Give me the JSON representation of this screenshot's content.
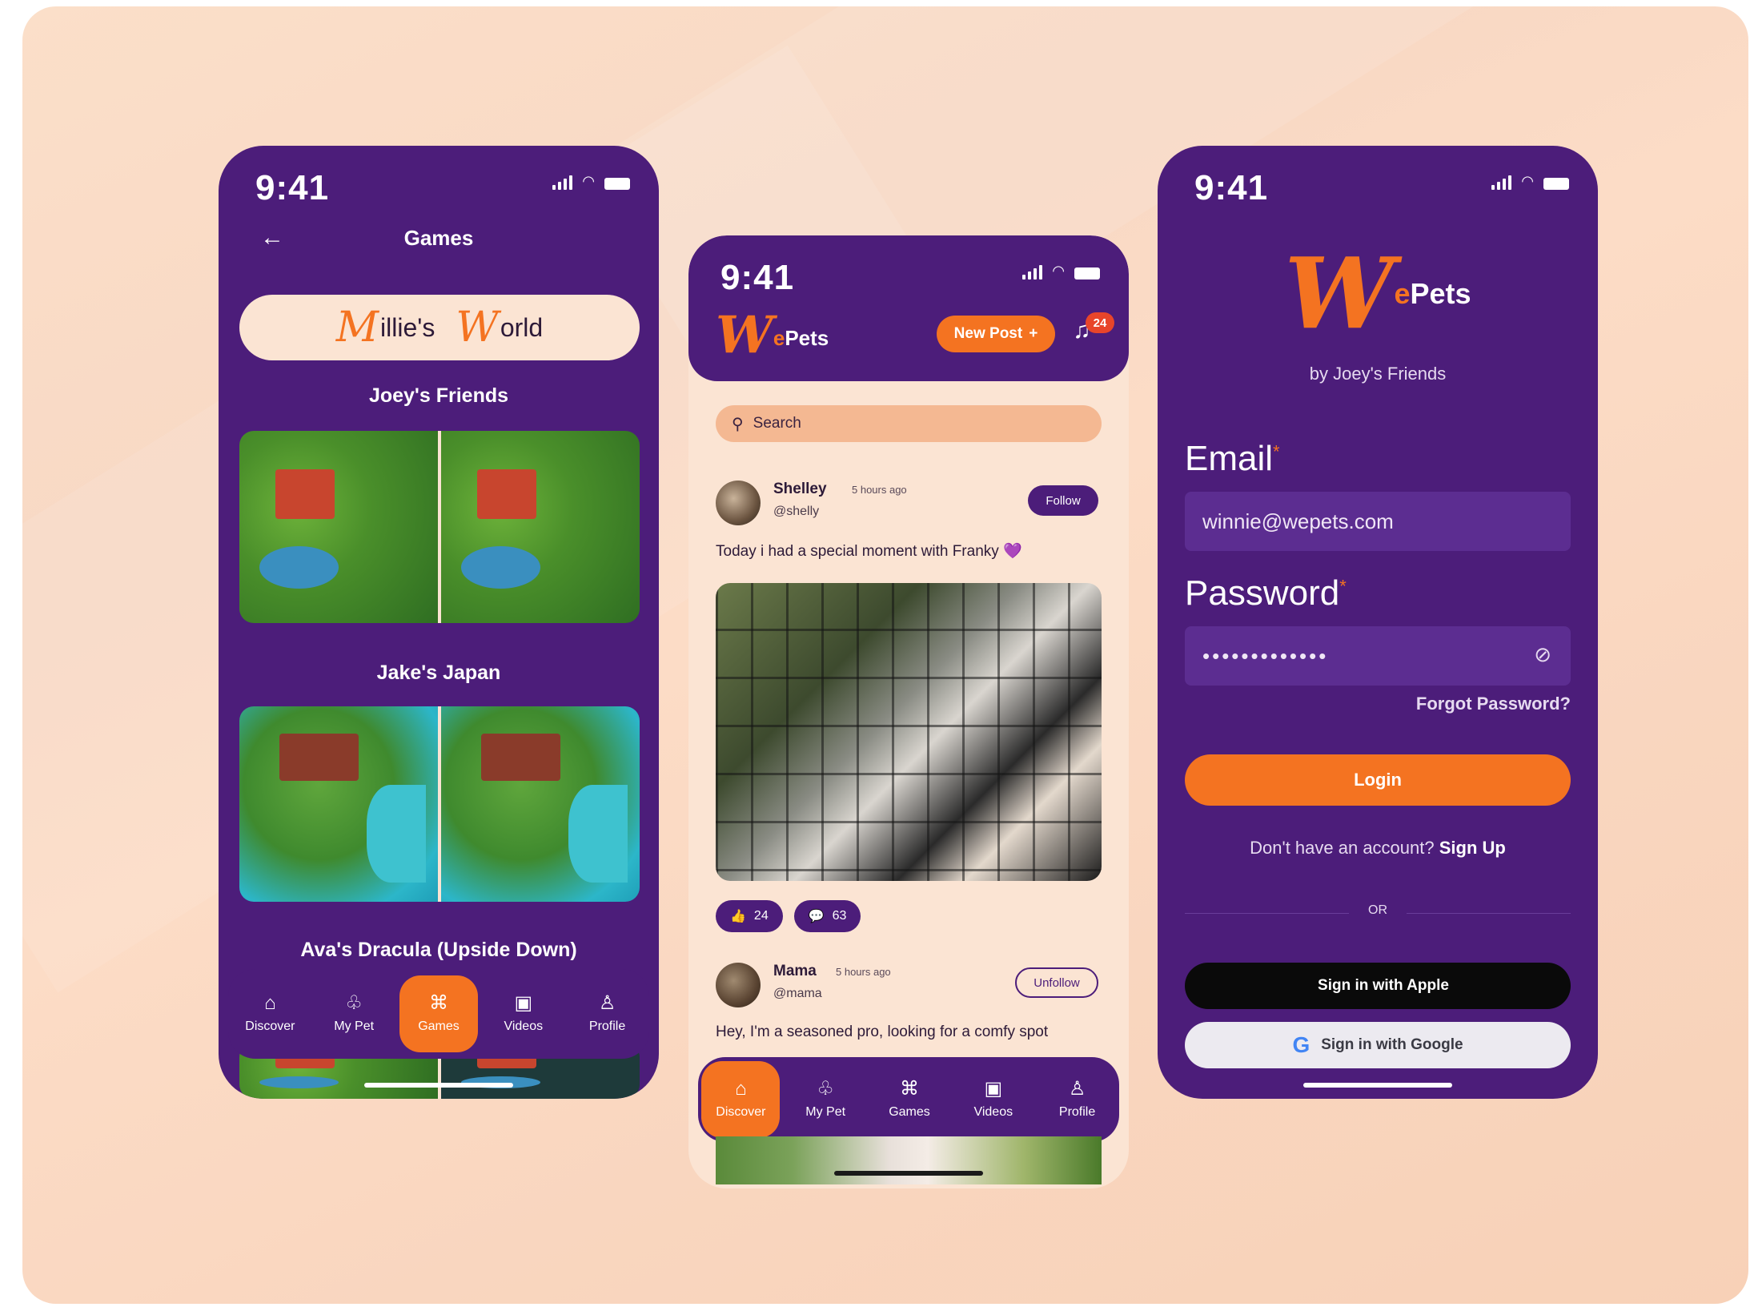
{
  "status": {
    "time": "9:41"
  },
  "games_screen": {
    "title": "Games",
    "banner": {
      "cap1": "M",
      "word1": "illie's",
      "cap2": "W",
      "word2": "orld"
    },
    "sections": [
      "Joey's Friends",
      "Jake's Japan",
      "Ava's Dracula (Upside Down)"
    ],
    "nav": [
      {
        "label": "Discover",
        "icon": "⌂"
      },
      {
        "label": "My Pet",
        "icon": "♧"
      },
      {
        "label": "Games",
        "icon": "⌘"
      },
      {
        "label": "Videos",
        "icon": "▣"
      },
      {
        "label": "Profile",
        "icon": "♙"
      }
    ],
    "active_tab": "Games"
  },
  "feed_screen": {
    "logo": {
      "w": "W",
      "e": "e",
      "pets": "Pets"
    },
    "new_post": "New Post",
    "new_post_icon": "+",
    "notification_count": "24",
    "search_placeholder": "Search",
    "posts": [
      {
        "name": "Shelley",
        "time": "5 hours ago",
        "handle": "@shelly",
        "action": "Follow",
        "text": "Today i had a special moment with Franky 💜",
        "likes": "24",
        "comments": "63"
      },
      {
        "name": "Mama",
        "time": "5 hours ago",
        "handle": "@mama",
        "action": "Unfollow",
        "text": "Hey, I'm a seasoned pro, looking for a comfy spot"
      }
    ],
    "nav": [
      {
        "label": "Discover",
        "icon": "⌂"
      },
      {
        "label": "My Pet",
        "icon": "♧"
      },
      {
        "label": "Games",
        "icon": "⌘"
      },
      {
        "label": "Videos",
        "icon": "▣"
      },
      {
        "label": "Profile",
        "icon": "♙"
      }
    ],
    "active_tab": "Discover"
  },
  "login_screen": {
    "logo": {
      "w": "W",
      "e": "e",
      "pets": "Pets"
    },
    "byline": "by Joey's Friends",
    "email_label": "Email",
    "email_value": "winnie@wepets.com",
    "password_label": "Password",
    "password_value": "•••••••••••••",
    "required_mark": "*",
    "forgot": "Forgot Password?",
    "login": "Login",
    "no_account": "Don't have an account?",
    "sign_up": "Sign Up",
    "or": "OR",
    "apple": "Sign in with Apple",
    "google": "Sign in with Google"
  },
  "colors": {
    "primary": "#4c1d7a",
    "accent": "#f47321",
    "cream": "#fbe4d3"
  }
}
